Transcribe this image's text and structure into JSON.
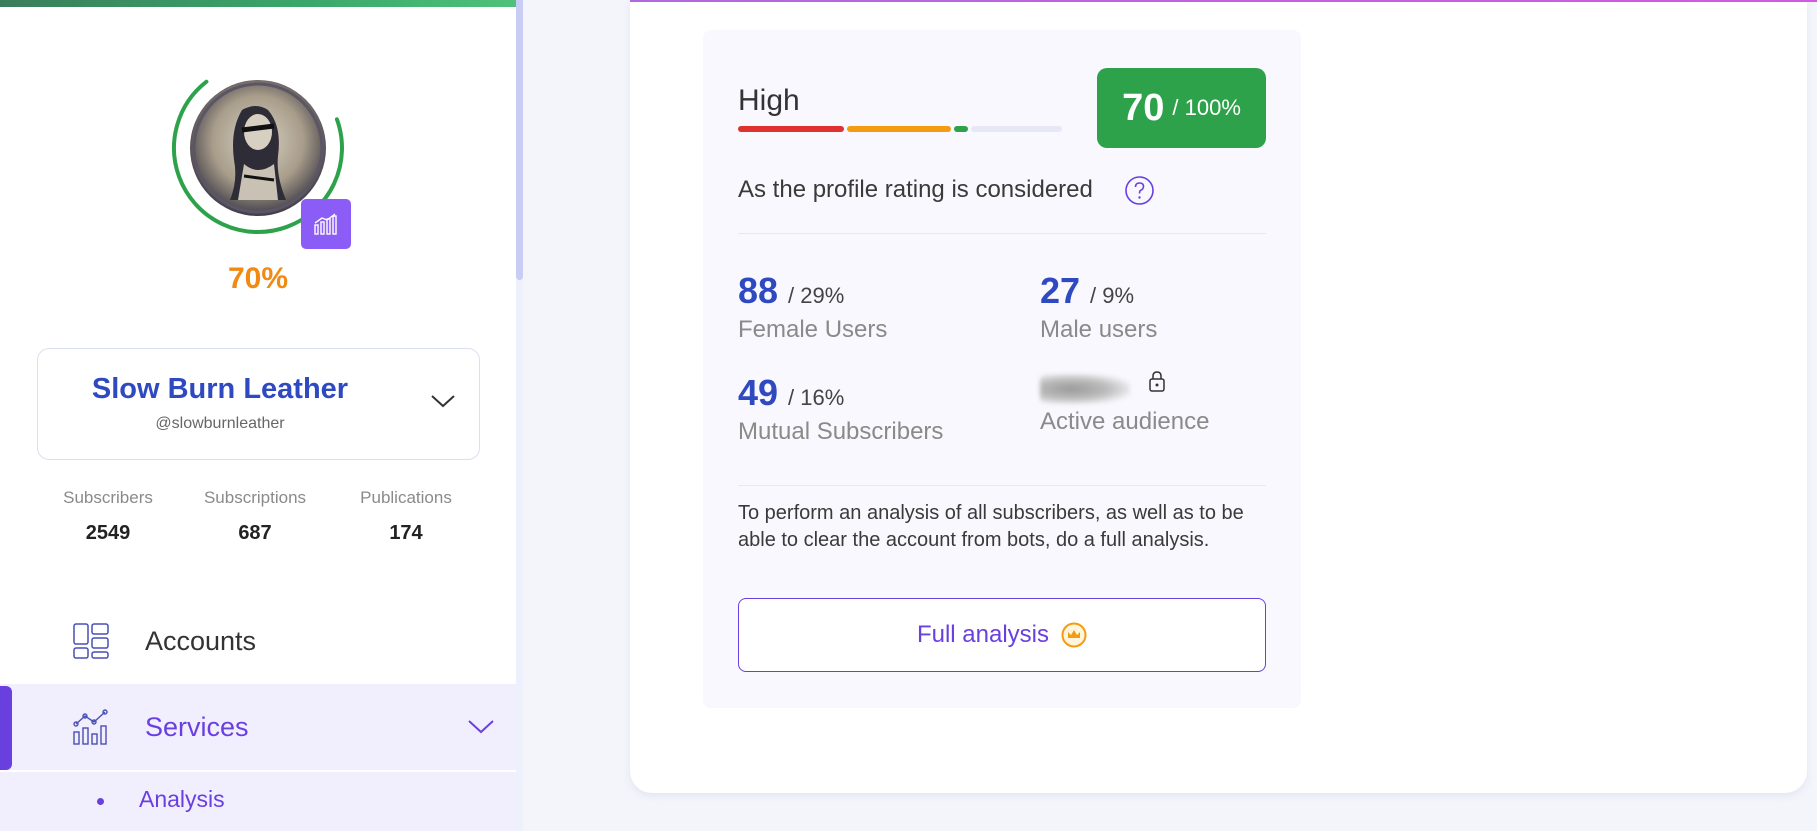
{
  "profile": {
    "rating_percent": "70%",
    "rating_fraction": 0.7,
    "name": "Slow Burn Leather",
    "handle": "@slowburnleather",
    "stats": [
      {
        "label": "Subscribers",
        "value": "2549"
      },
      {
        "label": "Subscriptions",
        "value": "687"
      },
      {
        "label": "Publications",
        "value": "174"
      }
    ]
  },
  "nav": {
    "items": [
      {
        "label": "Accounts",
        "icon": "dashboard-icon"
      },
      {
        "label": "Services",
        "icon": "analytics-chart-icon"
      }
    ],
    "subitems": [
      {
        "label": "Analysis"
      }
    ]
  },
  "rating_card": {
    "level": "High",
    "score": "70",
    "score_total": "/ 100%",
    "note": "As the profile rating is considered",
    "metrics": [
      {
        "value": "88",
        "share": "/ 29%",
        "label": "Female Users"
      },
      {
        "value": "27",
        "share": "/ 9%",
        "label": "Male users"
      },
      {
        "value": "49",
        "share": "/ 16%",
        "label": "Mutual Subscribers"
      },
      {
        "label": "Active audience",
        "locked": true
      }
    ],
    "analysis_text": "To perform an analysis of all subscribers, as well as to be able to clear the account from bots, do a full analysis.",
    "full_button": "Full analysis"
  },
  "colors": {
    "accent": "#6a3fe0",
    "brand_blue": "#2f4ac1",
    "success": "#2ea24a",
    "warning": "#f08a12",
    "danger": "#e03131"
  }
}
